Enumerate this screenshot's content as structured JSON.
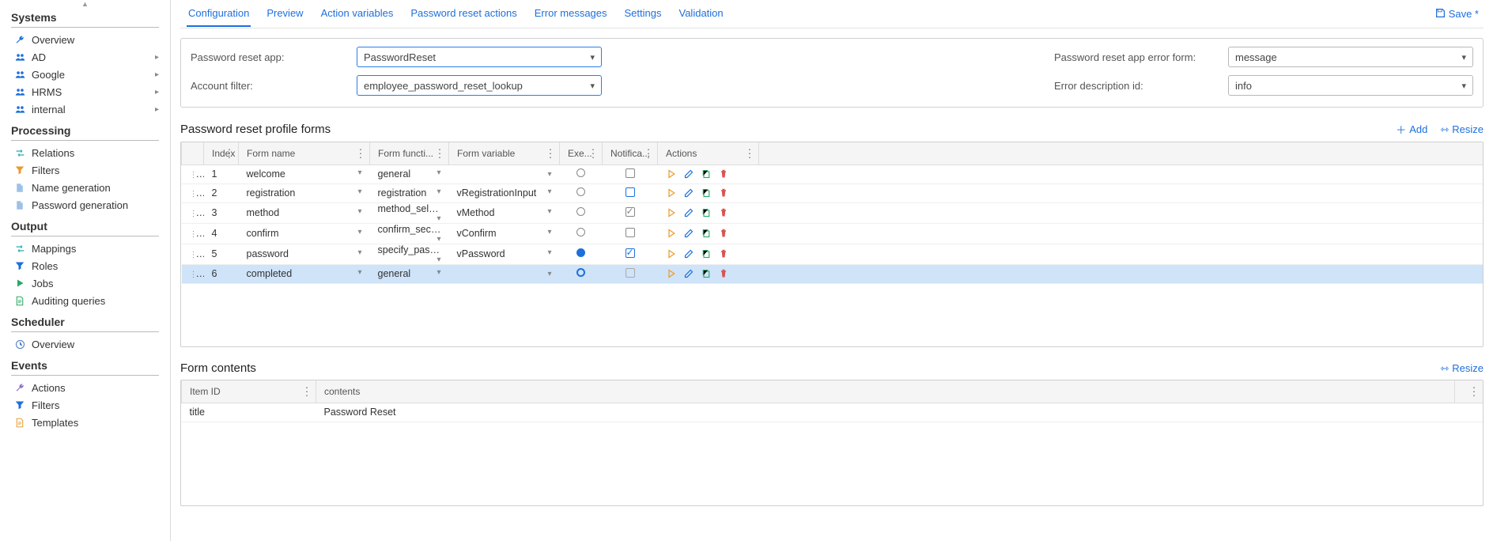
{
  "sidebar": {
    "sections": [
      {
        "title": "Systems",
        "items": [
          {
            "label": "Overview",
            "icon": "wrench",
            "color": "#1d6fdc",
            "expandable": false
          },
          {
            "label": "AD",
            "icon": "users",
            "color": "#1d6fdc",
            "expandable": true
          },
          {
            "label": "Google",
            "icon": "users",
            "color": "#1d6fdc",
            "expandable": true
          },
          {
            "label": "HRMS",
            "icon": "users",
            "color": "#1d6fdc",
            "expandable": true
          },
          {
            "label": "internal",
            "icon": "users",
            "color": "#1d6fdc",
            "expandable": true
          }
        ]
      },
      {
        "title": "Processing",
        "items": [
          {
            "label": "Relations",
            "icon": "arrows",
            "color": "#3bb4b4",
            "expandable": false
          },
          {
            "label": "Filters",
            "icon": "funnel",
            "color": "#e89b2a",
            "expandable": false
          },
          {
            "label": "Name generation",
            "icon": "doc",
            "color": "#9cc2e8",
            "expandable": false
          },
          {
            "label": "Password generation",
            "icon": "doc",
            "color": "#9cc2e8",
            "expandable": false
          }
        ]
      },
      {
        "title": "Output",
        "items": [
          {
            "label": "Mappings",
            "icon": "arrows",
            "color": "#3bb4b4",
            "expandable": false
          },
          {
            "label": "Roles",
            "icon": "funnel",
            "color": "#1d6fdc",
            "expandable": false
          },
          {
            "label": "Jobs",
            "icon": "play",
            "color": "#2aa866",
            "expandable": false
          },
          {
            "label": "Auditing queries",
            "icon": "docline",
            "color": "#2aa866",
            "expandable": false
          }
        ]
      },
      {
        "title": "Scheduler",
        "items": [
          {
            "label": "Overview",
            "icon": "clock",
            "color": "#5a88c9",
            "expandable": false
          }
        ]
      },
      {
        "title": "Events",
        "items": [
          {
            "label": "Actions",
            "icon": "wrench",
            "color": "#8a6fc4",
            "expandable": false
          },
          {
            "label": "Filters",
            "icon": "funnel",
            "color": "#1d6fdc",
            "expandable": false
          },
          {
            "label": "Templates",
            "icon": "docline",
            "color": "#e4a23a",
            "expandable": false
          }
        ]
      }
    ]
  },
  "topbar": {
    "tabs": [
      {
        "label": "Configuration",
        "active": true
      },
      {
        "label": "Preview",
        "active": false
      },
      {
        "label": "Action variables",
        "active": false
      },
      {
        "label": "Password reset actions",
        "active": false
      },
      {
        "label": "Error messages",
        "active": false
      },
      {
        "label": "Settings",
        "active": false
      },
      {
        "label": "Validation",
        "active": false
      }
    ],
    "save_label": "Save *"
  },
  "config": {
    "labels": {
      "app": "Password reset app:",
      "filter": "Account filter:",
      "error_form": "Password reset app error form:",
      "error_id": "Error description id:"
    },
    "values": {
      "app": "PasswordReset",
      "filter": "employee_password_reset_lookup",
      "error_form": "message",
      "error_id": "info"
    }
  },
  "section1": {
    "title": "Password reset profile forms",
    "add_label": "Add",
    "resize_label": "Resize"
  },
  "table1": {
    "headers": {
      "index": "Index",
      "name": "Form name",
      "func": "Form functi...",
      "var": "Form variable",
      "exec": "Exe...",
      "notif": "Notifica...",
      "actions": "Actions"
    },
    "rows": [
      {
        "idx": "1",
        "name": "welcome",
        "func": "general",
        "var": "",
        "exec": "empty",
        "notif": "empty",
        "selected": false
      },
      {
        "idx": "2",
        "name": "registration",
        "func": "registration",
        "var": "vRegistrationInput",
        "exec": "empty",
        "notif": "blue-empty",
        "selected": false
      },
      {
        "idx": "3",
        "name": "method",
        "func": "method_select",
        "var": "vMethod",
        "exec": "empty",
        "notif": "checked-gray",
        "selected": false
      },
      {
        "idx": "4",
        "name": "confirm",
        "func": "confirm_secret",
        "var": "vConfirm",
        "exec": "empty",
        "notif": "empty",
        "selected": false
      },
      {
        "idx": "5",
        "name": "password",
        "func": "specify_password",
        "var": "vPassword",
        "exec": "filled",
        "notif": "checked",
        "selected": false
      },
      {
        "idx": "6",
        "name": "completed",
        "func": "general",
        "var": "",
        "exec": "ring",
        "notif": "gray-empty",
        "selected": true
      }
    ]
  },
  "section2": {
    "title": "Form contents",
    "resize_label": "Resize"
  },
  "table2": {
    "headers": {
      "item_id": "Item ID",
      "contents": "contents"
    },
    "rows": [
      {
        "item_id": "title",
        "contents": "Password Reset"
      }
    ]
  }
}
